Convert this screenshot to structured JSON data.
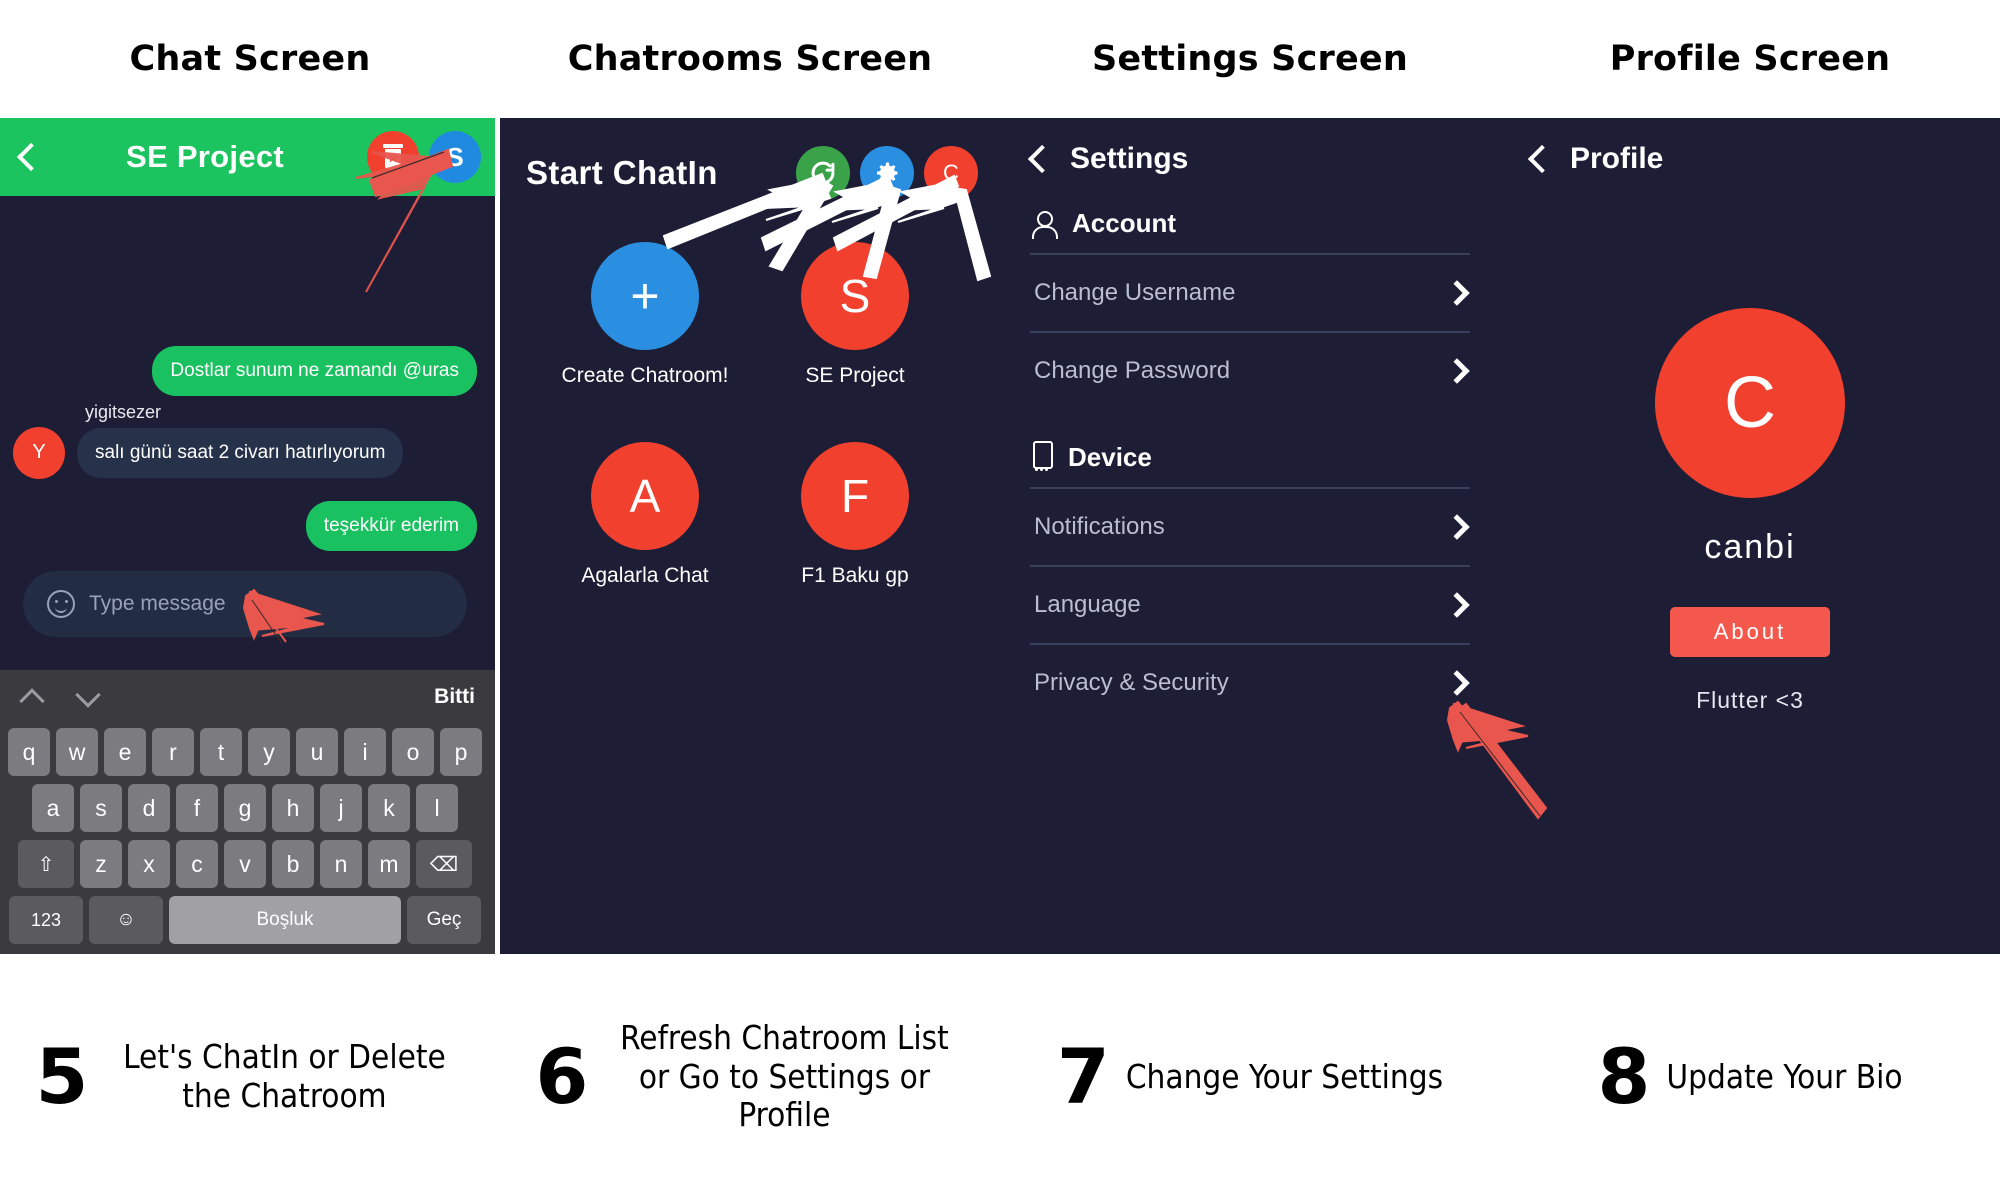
{
  "headers": [
    {
      "title": "Chat Screen"
    },
    {
      "title": "Chatrooms Screen"
    },
    {
      "title": "Settings Screen"
    },
    {
      "title": "Profile Screen"
    }
  ],
  "chat_screen": {
    "appbar": {
      "title": "SE Project",
      "back_icon": "chevron-left-icon",
      "delete_icon": "trash-delete-icon",
      "avatar_initial": "S"
    },
    "messages": [
      {
        "author": "",
        "text": "Dostlar sunum ne zamandı @uras",
        "side": "out"
      },
      {
        "author": "yigitsezer",
        "text": "salı günü saat 2 civarı hatırlıyorum",
        "side": "in",
        "avatar_initial": "Y"
      },
      {
        "author": "",
        "text": "teşekkür ederim",
        "side": "out"
      }
    ],
    "input": {
      "placeholder": "Type message",
      "value": "",
      "emoji_icon": "smiley-icon"
    },
    "keyboard": {
      "done_label": "Bitti",
      "row1": [
        "q",
        "w",
        "e",
        "r",
        "t",
        "y",
        "u",
        "i",
        "o",
        "p"
      ],
      "row2": [
        "a",
        "s",
        "d",
        "f",
        "g",
        "h",
        "j",
        "k",
        "l"
      ],
      "row3": [
        "z",
        "x",
        "c",
        "v",
        "b",
        "n",
        "m"
      ],
      "shift_label": "⇧",
      "backspace_label": "⌫",
      "numeric_label": "123",
      "emoji_label": "☺",
      "space_label": "Boşluk",
      "enter_label": "Geç"
    },
    "colors": {
      "appbar": "#1bc45f",
      "outgoing_bubble": "#19c160",
      "incoming_bubble": "#26324a",
      "background": "#1d1d35"
    }
  },
  "chatrooms_screen": {
    "title": "Start ChatIn",
    "actions": [
      {
        "name": "refresh",
        "icon": "refresh-icon",
        "color": "#3aa349",
        "label": ""
      },
      {
        "name": "settings",
        "icon": "gear-icon",
        "color": "#2a8fe0",
        "label": ""
      },
      {
        "name": "profile",
        "icon": "avatar-icon",
        "color": "#f2402f",
        "label": "C"
      }
    ],
    "rooms": [
      {
        "label": "Create Chatroom!",
        "initial": "+",
        "color": "#2a8fe0"
      },
      {
        "label": "SE Project",
        "initial": "S",
        "color": "#f2402f"
      },
      {
        "label": "Agalarla Chat",
        "initial": "A",
        "color": "#f2402f"
      },
      {
        "label": "F1 Baku gp",
        "initial": "F",
        "color": "#f2402f"
      }
    ]
  },
  "settings_screen": {
    "title": "Settings",
    "back_icon": "chevron-left-icon",
    "sections": [
      {
        "label": "Account",
        "icon": "person-icon",
        "rows": [
          {
            "label": "Change Username",
            "chevron": "chevron-right-icon"
          },
          {
            "label": "Change Password",
            "chevron": "chevron-right-icon"
          }
        ]
      },
      {
        "label": "Device",
        "icon": "device-icon",
        "rows": [
          {
            "label": "Notifications",
            "chevron": "chevron-right-icon"
          },
          {
            "label": "Language",
            "chevron": "chevron-right-icon"
          },
          {
            "label": "Privacy & Security",
            "chevron": "chevron-right-icon"
          }
        ]
      }
    ]
  },
  "profile_screen": {
    "title": "Profile",
    "back_icon": "chevron-left-icon",
    "avatar_initial": "C",
    "avatar_color": "#f2402f",
    "username": "canbi",
    "about_button": "About",
    "bio": "Flutter <3"
  },
  "captions": [
    {
      "number": "5",
      "text": "Let's ChatIn or Delete the Chatroom"
    },
    {
      "number": "6",
      "text": "Refresh Chatroom List or Go to Settings or Profile"
    },
    {
      "number": "7",
      "text": "Change Your Settings"
    },
    {
      "number": "8",
      "text": "Update Your Bio"
    }
  ]
}
